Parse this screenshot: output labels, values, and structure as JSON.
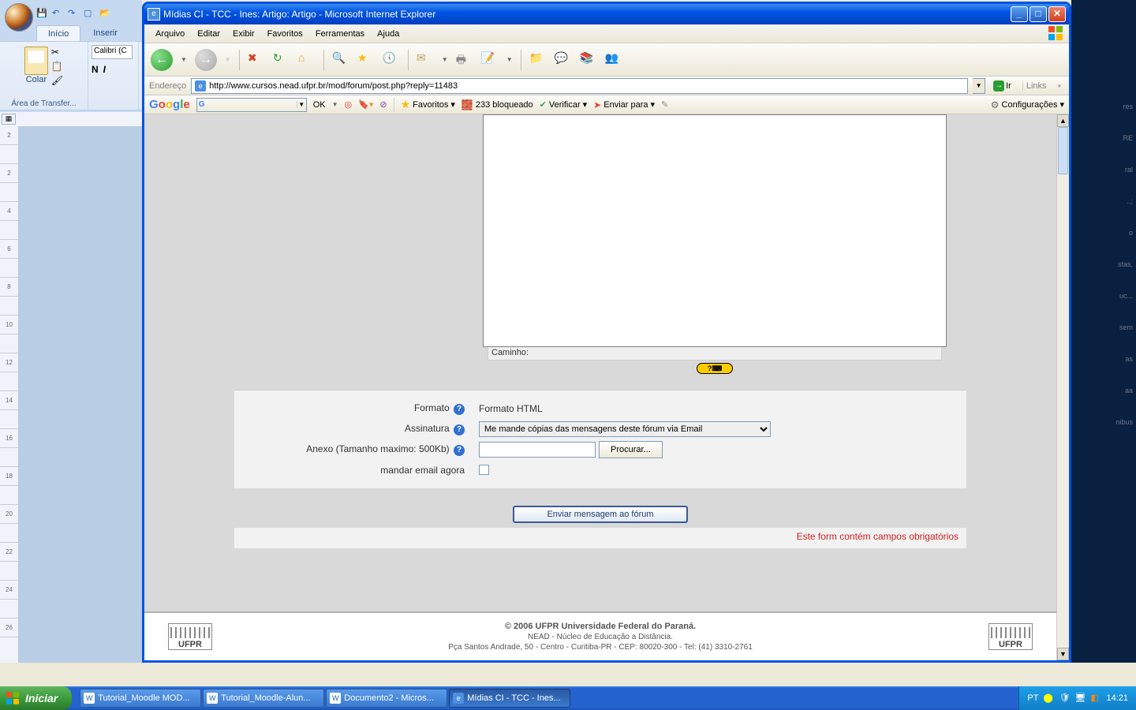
{
  "word": {
    "tabs": {
      "inicio": "Início",
      "inserir": "Inserir"
    },
    "colar_label": "Colar",
    "clipboard_group": "Área de Transfer...",
    "font_box": "Calibri (C",
    "bold": "N",
    "italic": "I"
  },
  "ie": {
    "title": "Mídias CI - TCC - Ines: Artigo: Artigo - Microsoft Internet Explorer",
    "menu": {
      "arquivo": "Arquivo",
      "editar": "Editar",
      "exibir": "Exibir",
      "favoritos": "Favoritos",
      "ferramentas": "Ferramentas",
      "ajuda": "Ajuda"
    },
    "addr_label": "Endereço",
    "url": "http://www.cursos.nead.ufpr.br/mod/forum/post.php?reply=11483",
    "ir": "Ir",
    "links": "Links"
  },
  "google": {
    "ok": "OK",
    "favoritos": "Favoritos",
    "blocked": "233 bloqueado",
    "verificar": "Verificar",
    "enviar": "Enviar para",
    "config": "Configurações"
  },
  "moodle": {
    "caminho": "Caminho:",
    "formato_label": "Formato",
    "formato_value": "Formato HTML",
    "assinatura_label": "Assinatura",
    "assinatura_value": "Me mande cópias das mensagens deste fórum via Email",
    "anexo_label": "Anexo (Tamanho maximo: 500Kb)",
    "procurar": "Procurar...",
    "mandar_email": "mandar email agora",
    "submit": "Enviar mensagem ao fórum",
    "required": "Este form contém campos obrigatórios"
  },
  "footer": {
    "copyright": "© 2006 UFPR Universidade Federal do Paraná.",
    "line2": "NEAD - Núcleo de Educação a Distância.",
    "line3": "Pça Santos Andrade, 50 - Centro - Curitiba-PR -  CEP: 80020-300 - Tel: (41) 3310-2761",
    "logo": "UFPR"
  },
  "taskbar": {
    "start": "Iniciar",
    "items": [
      "Tutorial_Moodle MOD...",
      "Tutorial_Moodle-Alun...",
      "Documento2 - Micros...",
      "Mídias CI - TCC - Ines..."
    ],
    "lang": "PT",
    "clock": "14:21"
  }
}
